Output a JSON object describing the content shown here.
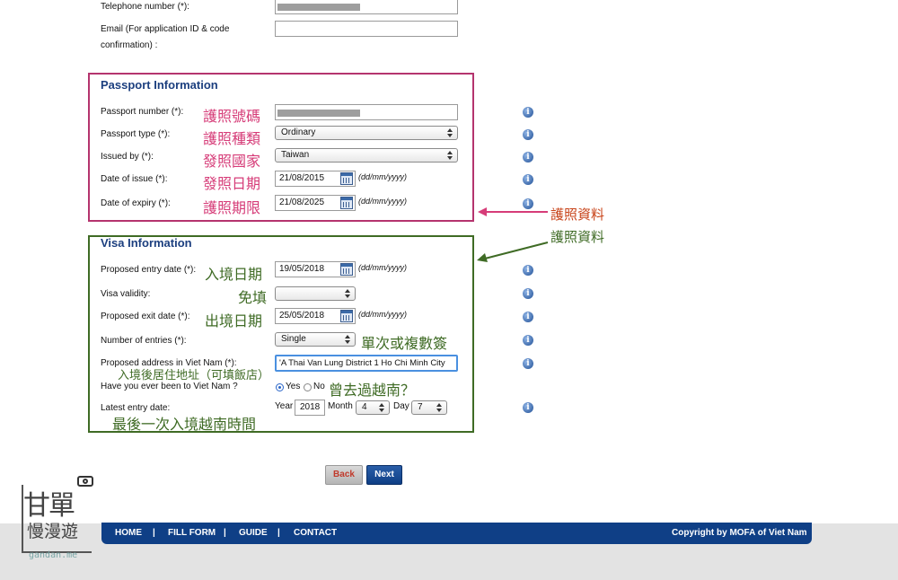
{
  "contact": {
    "telephone_label": "Telephone number (*):",
    "email_label_line1": "Email (For application ID & code",
    "email_label_line2": "confirmation) :"
  },
  "passport": {
    "title": "Passport Information",
    "number_label": "Passport number (*):",
    "number_note": "護照號碼",
    "type_label": "Passport type (*):",
    "type_note": "護照種類",
    "type_value": "Ordinary",
    "issued_label": "Issued by (*):",
    "issued_note": "發照國家",
    "issued_value": "Taiwan",
    "issue_date_label": "Date of issue (*):",
    "issue_date_note": "發照日期",
    "issue_date_value": "21/08/2015",
    "expiry_label": "Date of expiry (*):",
    "expiry_note": "護照期限",
    "expiry_value": "21/08/2025",
    "date_format": "(dd/mm/yyyy)",
    "annotation": "護照資料"
  },
  "visa": {
    "title": "Visa Information",
    "annotation": "護照資料",
    "entry_label": "Proposed entry date (*):",
    "entry_note": "入境日期",
    "entry_value": "19/05/2018",
    "validity_label": "Visa validity:",
    "validity_note": "免填",
    "exit_label": "Proposed exit date (*):",
    "exit_note": "出境日期",
    "exit_value": "25/05/2018",
    "entries_label": "Number of entries (*):",
    "entries_value": "Single",
    "entries_note": "單次或複數簽",
    "address_label": "Proposed address in Viet Nam (*):",
    "address_value": "'A Thai Van Lung District 1 Ho Chi Minh City",
    "address_note": "入境後居住地址（可填飯店）",
    "been_label": "Have you ever been to Viet Nam ?",
    "yes_label": "Yes",
    "no_label": "No",
    "been_note": "曾去過越南？",
    "latest_label": "Latest entry date:",
    "latest_note": "最後一次入境越南時間",
    "year_label": "Year",
    "year_value": "2018",
    "month_label": "Month",
    "month_value": "4",
    "day_label": "Day",
    "day_value": "7",
    "date_format": "(dd/mm/yyyy)"
  },
  "buttons": {
    "back": "Back",
    "next": "Next"
  },
  "footer": {
    "home": "HOME",
    "fill_form": "FILL FORM",
    "guide": "GUIDE",
    "contact": "CONTACT",
    "sep": "|",
    "copyright": "Copyright by MOFA of Viet Nam"
  },
  "watermark": {
    "line1": "甘單",
    "line2": "慢漫遊",
    "url": "gandan.me"
  },
  "info_icon": "i",
  "colors": {
    "pink": "#d63c78",
    "green": "#3f6b25",
    "navy": "#0f3f86",
    "title": "#1c3f7f"
  }
}
